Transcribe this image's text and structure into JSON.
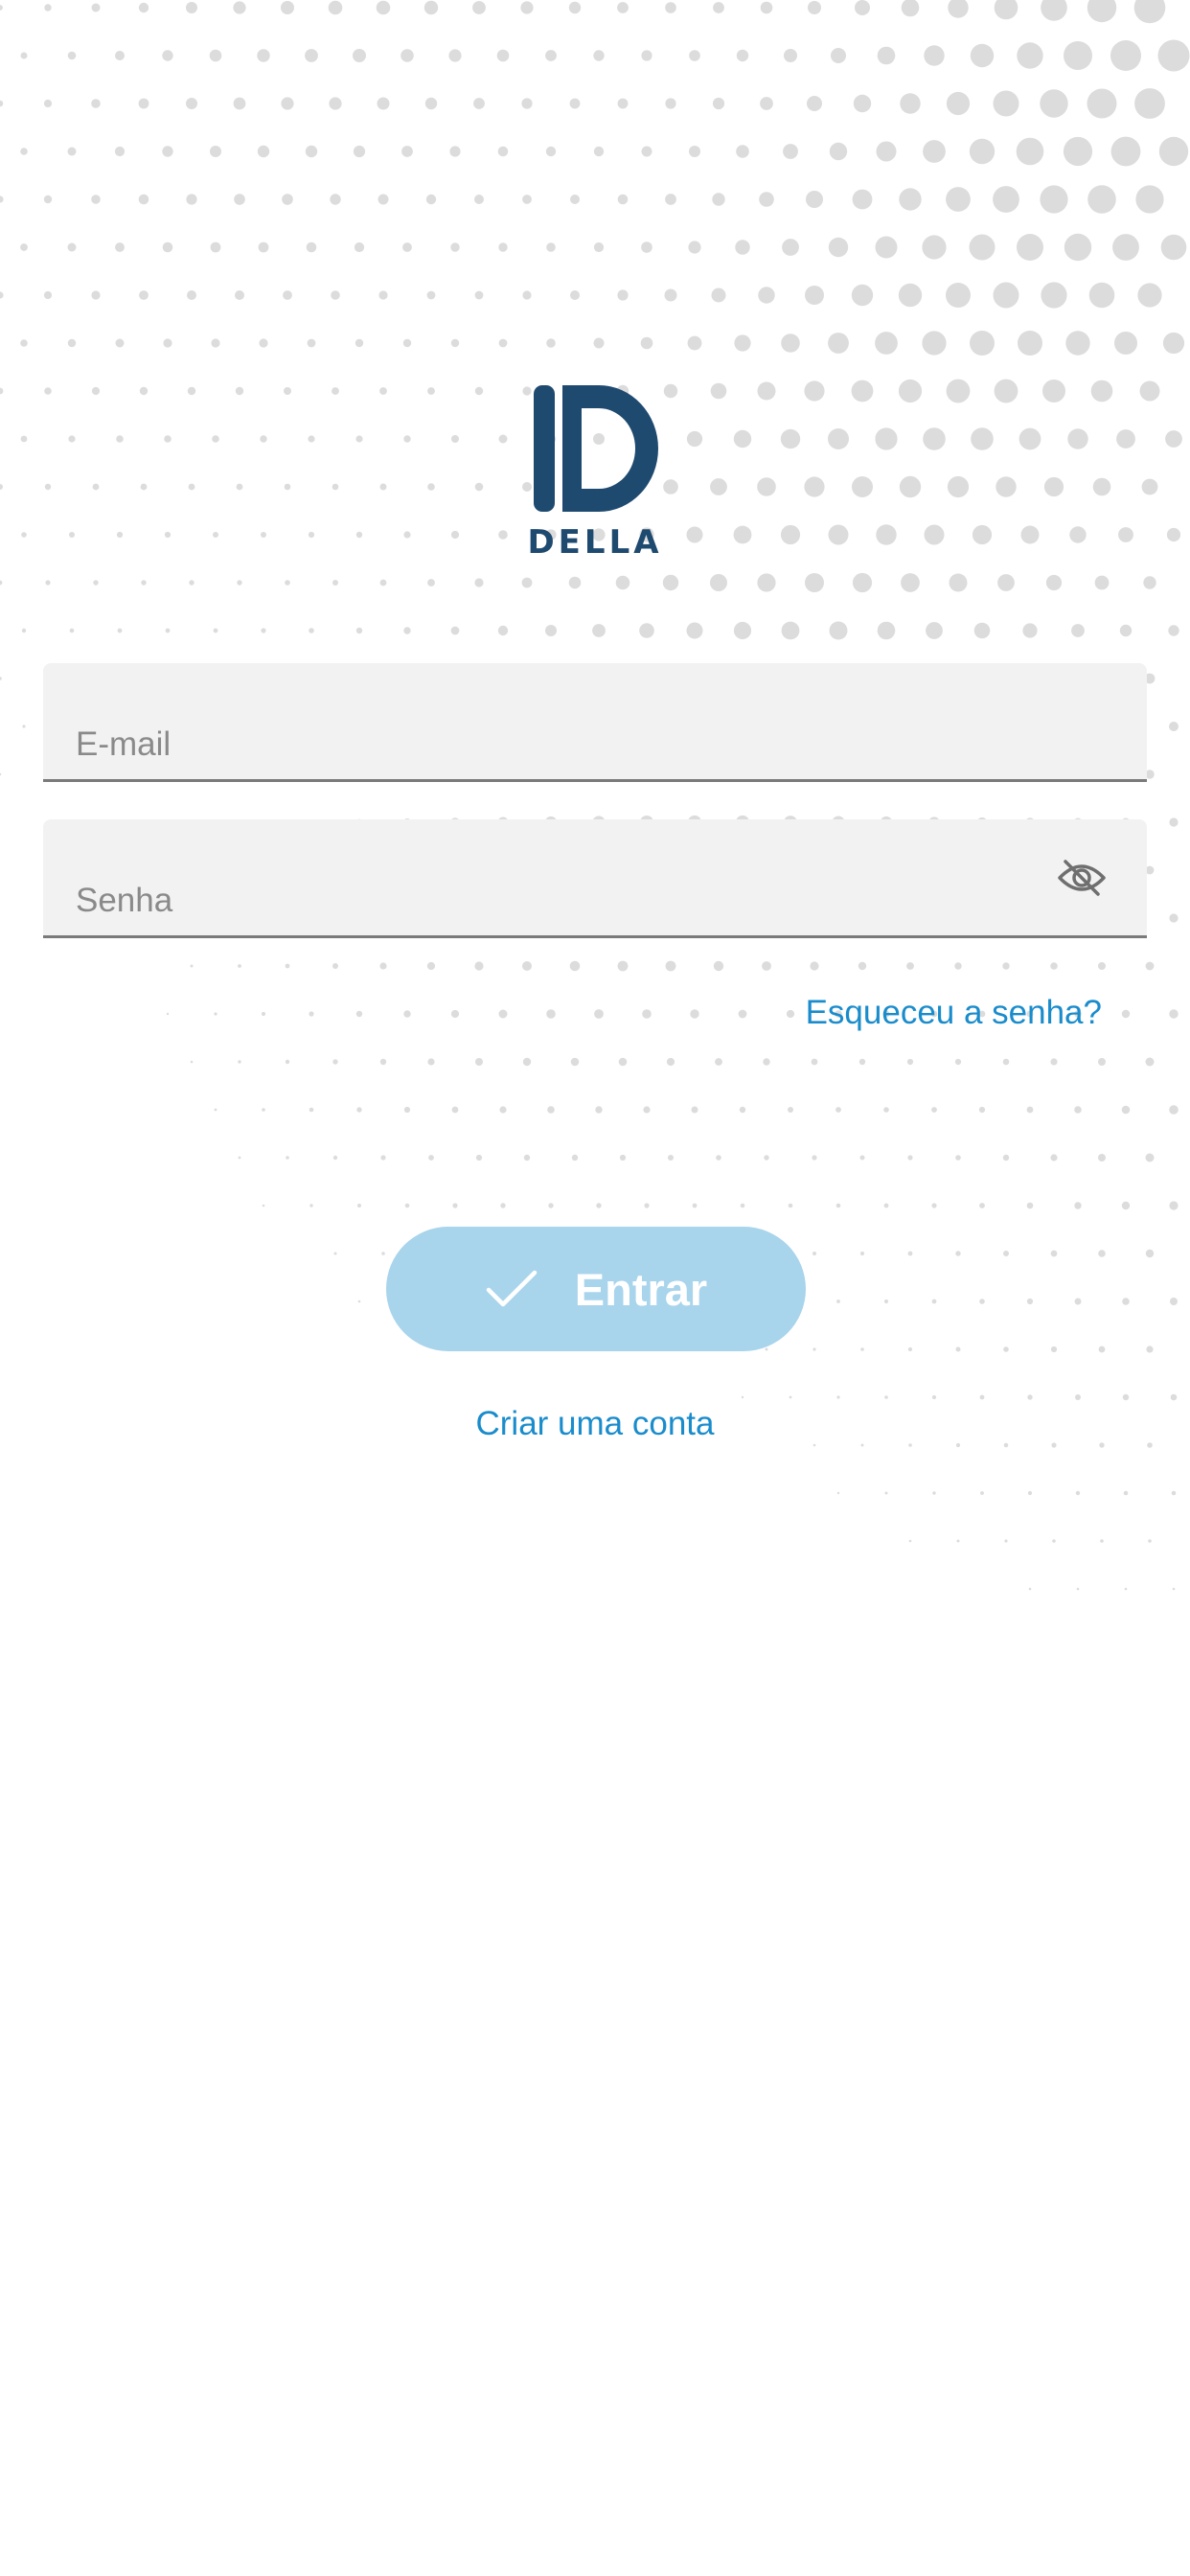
{
  "brand": {
    "name": "DELLA",
    "color": "#1f4a70"
  },
  "form": {
    "email": {
      "placeholder": "E-mail",
      "value": ""
    },
    "password": {
      "placeholder": "Senha",
      "value": "",
      "toggle_icon": "eye-off-icon"
    },
    "forgot_password_label": "Esqueceu a senha?",
    "submit": {
      "label": "Entrar",
      "icon": "check-icon",
      "state": "disabled"
    },
    "create_account_label": "Criar uma conta"
  },
  "theme": {
    "accent": "#1a8ccc",
    "button_bg": "#a8d4ec",
    "field_bg": "#f2f2f2",
    "pattern_dots": "#dcdcdc"
  }
}
